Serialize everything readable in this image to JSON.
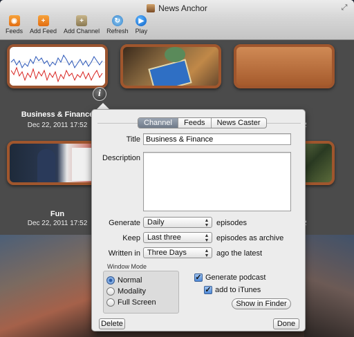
{
  "window": {
    "title": "News Anchor"
  },
  "toolbar": {
    "items": [
      {
        "label": "Feeds",
        "icon": "rss-icon"
      },
      {
        "label": "Add Feed",
        "icon": "add-feed-icon"
      },
      {
        "label": "Add Channel",
        "icon": "add-channel-icon"
      },
      {
        "label": "Refresh",
        "icon": "refresh-icon"
      },
      {
        "label": "Play",
        "icon": "play-icon"
      }
    ]
  },
  "channels": [
    {
      "title": "Business & Finance",
      "date": "Dec 22, 2011 17:52"
    },
    {
      "title": "",
      "date": ""
    },
    {
      "title": "",
      "date": "2"
    },
    {
      "title": "Fun",
      "date": "Dec 22, 2011 17:52"
    },
    {
      "title": "",
      "date": "2"
    }
  ],
  "inspector": {
    "tabs": [
      "Channel",
      "Feeds",
      "News Caster"
    ],
    "active_tab": "Channel",
    "title_label": "Title",
    "title_value": "Business & Finance",
    "description_label": "Description",
    "description_value": "",
    "generate_label": "Generate",
    "generate_value": "Daily",
    "generate_suffix": "episodes",
    "keep_label": "Keep",
    "keep_value": "Last three",
    "keep_suffix": "episodes as archive",
    "written_label": "Written in",
    "written_value": "Three Days",
    "written_suffix": "ago the latest",
    "window_mode": {
      "label": "Window Mode",
      "options": [
        "Normal",
        "Modality",
        "Full Screen"
      ],
      "selected": "Normal"
    },
    "generate_podcast_label": "Generate podcast",
    "generate_podcast_checked": true,
    "add_itunes_label": "add to iTunes",
    "add_itunes_checked": true,
    "show_finder_label": "Show in Finder",
    "delete_label": "Delete",
    "done_label": "Done"
  },
  "colors": {
    "thumb_border": "#a0562d",
    "tab_active": "#6f7a8a",
    "checkbox_blue": "#4f8ad8"
  }
}
